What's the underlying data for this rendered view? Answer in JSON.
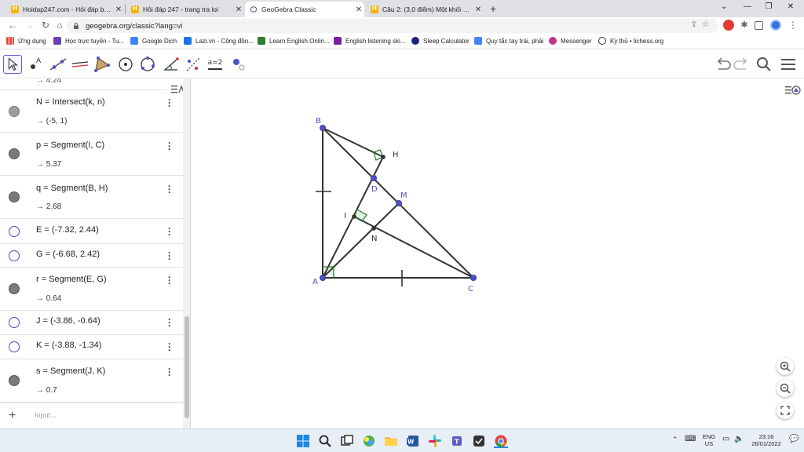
{
  "browser": {
    "tabs": [
      {
        "title": "Hoidap247.com - Hỏi đáp bài tập",
        "active": false
      },
      {
        "title": "Hỏi đáp 247 - trang tra loi",
        "active": false
      },
      {
        "title": "GeoGebra Classic",
        "active": true
      },
      {
        "title": "Câu 2: (3,0 điểm) Một khối gỗ đặ",
        "active": false
      }
    ],
    "url": "geogebra.org/classic?lang=vi",
    "bookmarks": [
      "Ứng dụng",
      "Học trực tuyến - Tu...",
      "Google Dịch",
      "Lazi.vn - Cộng đồn...",
      "Learn English Onlin...",
      "English listening ski...",
      "Sleep Calculator",
      "Quy tắc tay trái, phải",
      "Messenger",
      "Kỳ thủ • lichess.org"
    ]
  },
  "toolbar": {
    "slider_tool_label": "a=2"
  },
  "algebra": {
    "top_value": "→ 4.24",
    "rows": [
      {
        "expr": "N = Intersect(k, n)",
        "value": "→ (-5, 1)",
        "visible": true,
        "color": "#9e9e9e"
      },
      {
        "expr": "p = Segment(I, C)",
        "value": "→ 5.37",
        "visible": true,
        "color": "#616161"
      },
      {
        "expr": "q = Segment(B, H)",
        "value": "→ 2.68",
        "visible": true,
        "color": "#616161"
      },
      {
        "expr": "E = (-7.32, 2.44)",
        "value": "",
        "visible": false,
        "color": "#4a4ac8"
      },
      {
        "expr": "G = (-6.68, 2.42)",
        "value": "",
        "visible": false,
        "color": "#4a4ac8"
      },
      {
        "expr": "r = Segment(E, G)",
        "value": "→ 0.64",
        "visible": true,
        "color": "#616161"
      },
      {
        "expr": "J = (-3.86, -0.64)",
        "value": "",
        "visible": false,
        "color": "#4a4ac8"
      },
      {
        "expr": "K = (-3.88, -1.34)",
        "value": "",
        "visible": false,
        "color": "#4a4ac8"
      },
      {
        "expr": "s = Segment(J, K)",
        "value": "→ 0.7",
        "visible": true,
        "color": "#616161"
      }
    ],
    "input_placeholder": "Input..."
  },
  "graphics": {
    "point_labels": {
      "A": "A",
      "B": "B",
      "C": "C",
      "D": "D",
      "H": "H",
      "I": "I",
      "M": "M",
      "N": "N"
    }
  },
  "taskbar": {
    "lang_top": "ENG",
    "lang_bottom": "US",
    "time": "23:16",
    "date": "26/01/2022"
  }
}
